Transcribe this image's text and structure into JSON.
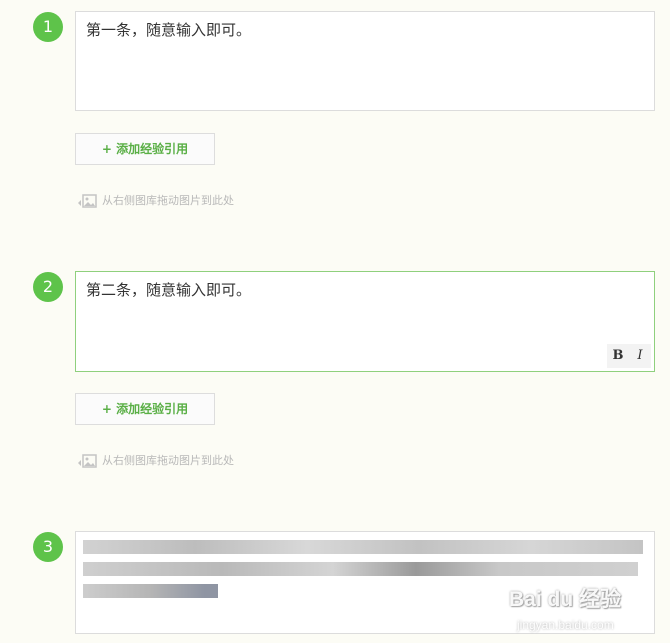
{
  "steps": [
    {
      "number": "1",
      "text": "第一条，随意输入即可。"
    },
    {
      "number": "2",
      "text": "第二条，随意输入即可。"
    },
    {
      "number": "3",
      "text": ""
    }
  ],
  "add_reference_label": "+ 添加经验引用",
  "drag_hint": "从右侧图库拖动图片到此处",
  "format_bar": {
    "bold": "B",
    "italic": "I"
  },
  "watermark": {
    "brand": "Bai du 经验",
    "url": "jingyan.baidu.com"
  },
  "colors": {
    "accent": "#5ec34a",
    "link": "#5aaf46",
    "background": "#fcfcf5"
  }
}
